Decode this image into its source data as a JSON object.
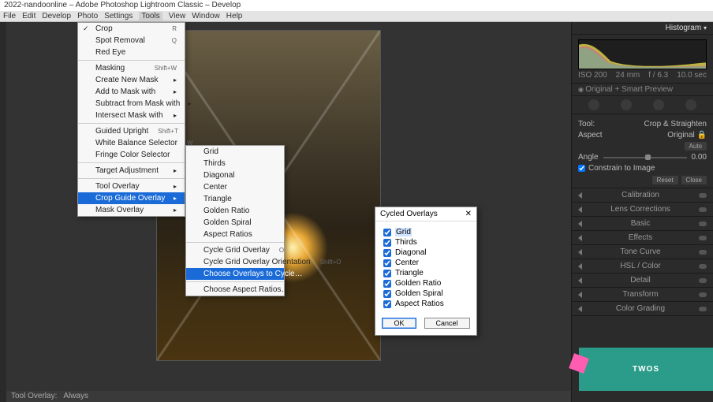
{
  "window": {
    "title": "2022-nandoonline – Adobe Photoshop Lightroom Classic – Develop"
  },
  "menubar": [
    "File",
    "Edit",
    "Develop",
    "Photo",
    "Settings",
    "Tools",
    "View",
    "Window",
    "Help"
  ],
  "toolsMenu": {
    "items": [
      {
        "label": "Crop",
        "shortcut": "R",
        "check": true
      },
      {
        "label": "Spot Removal",
        "shortcut": "Q"
      },
      {
        "label": "Red Eye"
      },
      {
        "sep": true
      },
      {
        "label": "Masking",
        "shortcut": "Shift+W"
      },
      {
        "label": "Create New Mask",
        "arrow": true
      },
      {
        "label": "Add to Mask with",
        "arrow": true
      },
      {
        "label": "Subtract from Mask with",
        "arrow": true
      },
      {
        "label": "Intersect Mask with",
        "arrow": true
      },
      {
        "sep": true
      },
      {
        "label": "Guided Upright",
        "shortcut": "Shift+T"
      },
      {
        "label": "White Balance Selector",
        "shortcut": "W"
      },
      {
        "label": "Fringe Color Selector"
      },
      {
        "sep": true
      },
      {
        "label": "Target Adjustment",
        "arrow": true
      },
      {
        "sep": true
      },
      {
        "label": "Tool Overlay",
        "arrow": true
      },
      {
        "label": "Crop Guide Overlay",
        "arrow": true,
        "sel": true
      },
      {
        "label": "Mask Overlay",
        "arrow": true
      }
    ]
  },
  "cropSubMenu": {
    "items": [
      {
        "label": "Grid"
      },
      {
        "label": "Thirds"
      },
      {
        "label": "Diagonal"
      },
      {
        "label": "Center"
      },
      {
        "label": "Triangle"
      },
      {
        "label": "Golden Ratio"
      },
      {
        "label": "Golden Spiral"
      },
      {
        "label": "Aspect Ratios"
      },
      {
        "sep": true
      },
      {
        "label": "Cycle Grid Overlay",
        "shortcut": "O"
      },
      {
        "label": "Cycle Grid Overlay Orientation",
        "shortcut": "Shift+O"
      },
      {
        "label": "Choose Overlays to Cycle…",
        "sel": true
      },
      {
        "sep": true
      },
      {
        "label": "Choose Aspect Ratios…"
      }
    ]
  },
  "dialog": {
    "title": "Cycled Overlays",
    "options": [
      {
        "label": "Grid",
        "checked": true,
        "hl": true
      },
      {
        "label": "Thirds",
        "checked": true
      },
      {
        "label": "Diagonal",
        "checked": true
      },
      {
        "label": "Center",
        "checked": true
      },
      {
        "label": "Triangle",
        "checked": true
      },
      {
        "label": "Golden Ratio",
        "checked": true
      },
      {
        "label": "Golden Spiral",
        "checked": true
      },
      {
        "label": "Aspect Ratios",
        "checked": true
      }
    ],
    "ok": "OK",
    "cancel": "Cancel"
  },
  "right": {
    "histogram": "Histogram",
    "info": {
      "iso": "ISO 200",
      "focal": "24 mm",
      "ap": "f / 6.3",
      "ss": "10.0 sec"
    },
    "originalSmart": "Original + Smart Preview",
    "toolTitle": "Tool:",
    "toolName": "Crop & Straighten",
    "aspect": "Aspect",
    "aspectValue": "Original",
    "angle": "Angle",
    "autoBtn": "Auto",
    "angleValue": "0.00",
    "constrain": "Constrain to Image",
    "reset": "Reset",
    "close": "Close",
    "panels": [
      "Calibration",
      "Lens Corrections",
      "Basic",
      "Effects",
      "Tone Curve",
      "HSL / Color",
      "Detail",
      "Transform",
      "Color Grading"
    ]
  },
  "statusbar": {
    "a": "Tool Overlay:",
    "b": "Always"
  },
  "logo": "TWOS"
}
